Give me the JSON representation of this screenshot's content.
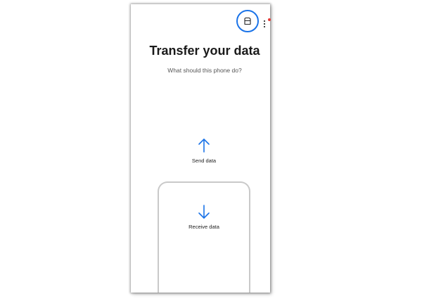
{
  "header": {
    "title": "Transfer your data",
    "subtitle": "What should this phone do?"
  },
  "options": {
    "send": {
      "label": "Send data",
      "icon": "arrow-up-icon"
    },
    "receive": {
      "label": "Receive data",
      "icon": "arrow-down-icon"
    }
  },
  "toolbar": {
    "storage_icon": "sd-card-icon",
    "more_icon": "more-vertical-icon"
  },
  "colors": {
    "accent": "#1a73e8",
    "notification_dot": "#e53935"
  }
}
